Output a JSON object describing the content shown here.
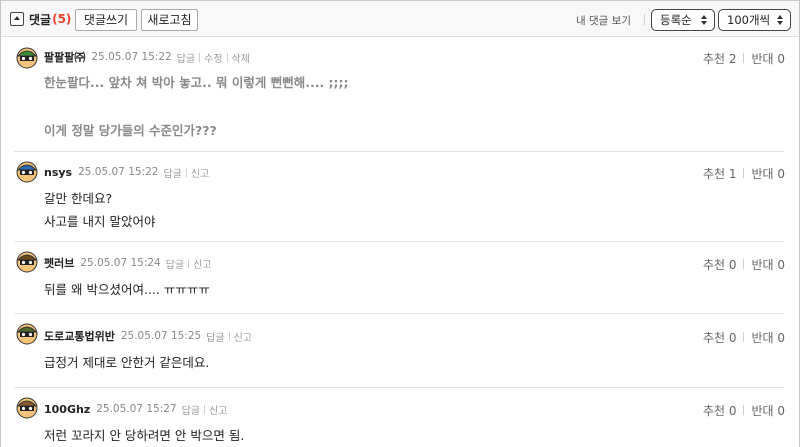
{
  "toolbar": {
    "toggle_label": "댓글",
    "comment_count": "(5)",
    "write_button": "댓글쓰기",
    "refresh_button": "새로고침",
    "view_label": "내 댓글 보기",
    "order_select": "등록순",
    "count_select": "100개씩"
  },
  "comments": [
    {
      "nickname": "팔팔팔㈜",
      "date": "25.05.07 15:22",
      "links": [
        "답글",
        "수정",
        "삭제"
      ],
      "up_label": "추천 2",
      "down_label": "반대 0",
      "lines": [
        "한눈팔다... 앞차 쳐 박아 놓고.. 뭐 이렇게 뻔뻔해.... ;;;;",
        "이게 정말 당가들의 수준인가???"
      ],
      "avatar_color": "#3a8f3a"
    },
    {
      "nickname": "nsys",
      "date": "25.05.07 15:22",
      "links": [
        "답글",
        "신고"
      ],
      "up_label": "추천 1",
      "down_label": "반대 0",
      "lines": [
        "갈만 한데요?",
        "사고를 내지 말았어야"
      ],
      "avatar_color": "#2a6bb5"
    },
    {
      "nickname": "펫러브",
      "date": "25.05.07 15:24",
      "links": [
        "답글",
        "신고"
      ],
      "up_label": "추천 0",
      "down_label": "반대 0",
      "lines": [
        "뒤를 왜 박으셨어여.... ㅠㅠㅠㅠ"
      ],
      "avatar_color": "#6b4a1a"
    },
    {
      "nickname": "도로교통법위반",
      "date": "25.05.07 15:25",
      "links": [
        "답글",
        "신고"
      ],
      "up_label": "추천 0",
      "down_label": "반대 0",
      "lines": [
        "급정거 제대로 안한거 같은데요."
      ],
      "avatar_color": "#4a6b2a"
    },
    {
      "nickname": "100Ghz",
      "date": "25.05.07 15:27",
      "links": [
        "답글",
        "신고"
      ],
      "up_label": "추천 0",
      "down_label": "반대 0",
      "lines": [
        "저런 꼬라지 안 당하려면 안 박으면 됨."
      ],
      "avatar_color": "#8a5a2a"
    }
  ]
}
